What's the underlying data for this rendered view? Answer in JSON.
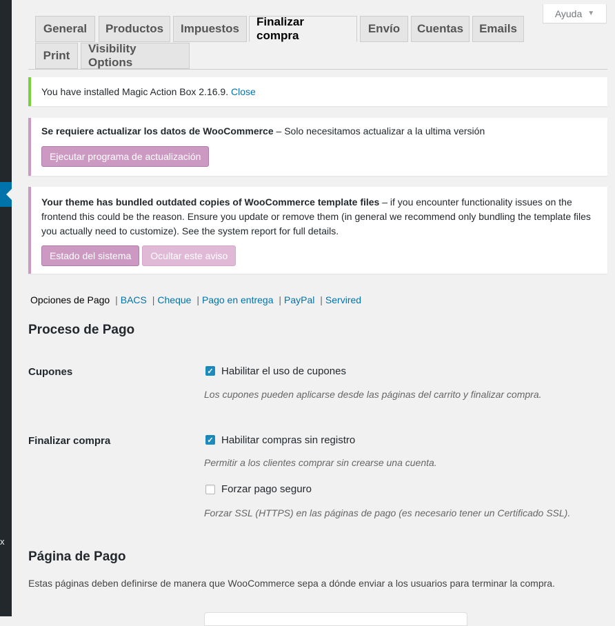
{
  "help": {
    "label": "Ayuda"
  },
  "tabs": [
    {
      "label": "General"
    },
    {
      "label": "Productos"
    },
    {
      "label": "Impuestos"
    },
    {
      "label": "Finalizar compra"
    },
    {
      "label": "Envío"
    },
    {
      "label": "Cuentas"
    },
    {
      "label": "Emails"
    },
    {
      "label": "Print"
    },
    {
      "label": "Visibility Options"
    }
  ],
  "notices": {
    "mab": {
      "text": "You have installed Magic Action Box 2.16.9.",
      "link": "Close"
    },
    "update": {
      "strong": "Se requiere actualizar los datos de WooCommerce",
      "text": " – Solo necesitamos actualizar a la ultima versión",
      "button": "Ejecutar programa de actualización"
    },
    "theme": {
      "strong": "Your theme has bundled outdated copies of WooCommerce template files",
      "text": " – if you encounter functionality issues on the frontend this could be the reason. Ensure you update or remove them (in general we recommend only bundling the template files you actually need to customize). See the system report for full details.",
      "button_status": "Estado del sistema",
      "button_hide": "Ocultar este aviso"
    }
  },
  "subnav": {
    "current": "Opciones de Pago",
    "sep": "|",
    "links": [
      "BACS",
      "Cheque",
      "Pago en entrega",
      "PayPal",
      "Servired"
    ]
  },
  "process": {
    "title": "Proceso de Pago",
    "coupons": {
      "label": "Cupones",
      "checkbox": "Habilitar el uso de cupones",
      "desc": "Los cupones pueden aplicarse desde las páginas del carrito y finalizar compra."
    },
    "checkout": {
      "label": "Finalizar compra",
      "guest": "Habilitar compras sin registro",
      "guest_desc": "Permitir a los clientes comprar sin crearse una cuenta.",
      "ssl": "Forzar pago seguro",
      "ssl_desc": "Forzar SSL (HTTPS) en las páginas de pago (es necesario tener un Certificado SSL)."
    }
  },
  "pages": {
    "title": "Página de Pago",
    "intro": "Estas páginas deben definirse de manera que WooCommerce sepa a dónde enviar a los usuarios para terminar la compra."
  },
  "sidebar": {
    "partial_glyph": "x"
  },
  "colors": {
    "accent": "#0073aa",
    "woo_purple": "#cc99c2",
    "success": "#7ad03a"
  }
}
